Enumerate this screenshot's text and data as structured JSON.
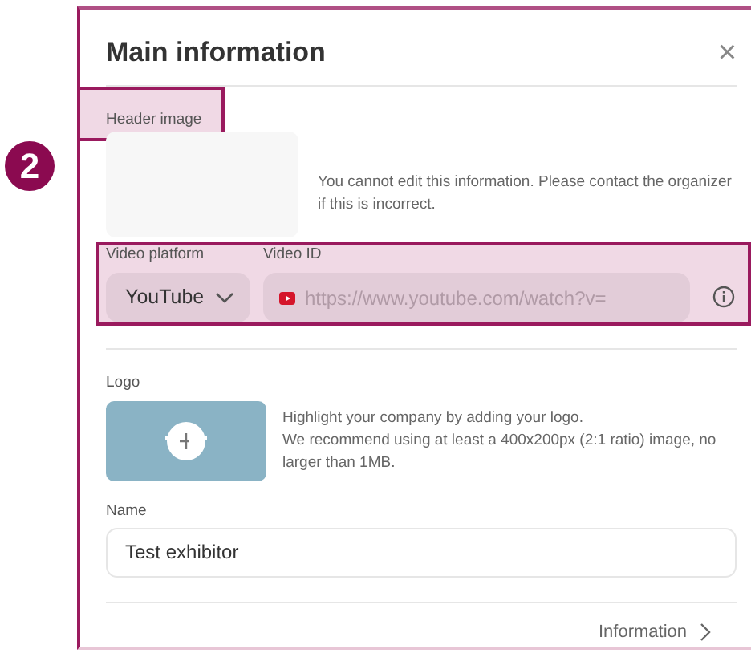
{
  "step_badge": "2",
  "dialog": {
    "title": "Main information",
    "close": "×"
  },
  "header_image": {
    "label": "Header image",
    "highlighted": true,
    "note": "You cannot edit this information. Please contact the organizer if this is incorrect."
  },
  "video": {
    "highlighted": true,
    "platform_label": "Video platform",
    "platform_value": "YouTube",
    "id_label": "Video ID",
    "id_placeholder": "https://www.youtube.com/watch?v="
  },
  "logo": {
    "label": "Logo",
    "lines": [
      "Highlight your company by adding your logo.",
      "We recommend using at least a 400x200px (2:1 ratio) image, no larger than 1MB."
    ]
  },
  "name": {
    "label": "Name",
    "value": "Test exhibitor"
  },
  "footer": {
    "next_link": "Information"
  }
}
